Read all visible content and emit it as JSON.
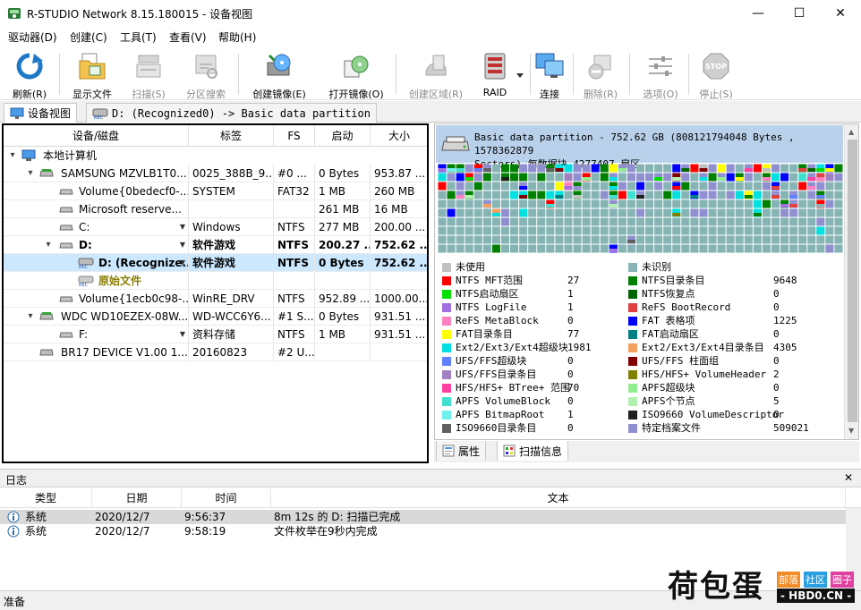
{
  "window": {
    "title": "R-STUDIO Network 8.15.180015 - 设备视图",
    "minimize": "—",
    "maximize": "☐",
    "close": "✕"
  },
  "menu": [
    "驱动器(D)",
    "创建(C)",
    "工具(T)",
    "查看(V)",
    "帮助(H)"
  ],
  "toolbar": {
    "refresh": "刷新(R)",
    "show_files": "显示文件",
    "scan": "扫描(S)",
    "partition_search": "分区搜索",
    "create_image": "创建镜像(E)",
    "open_image": "打开镜像(O)",
    "create_region": "创建区域(R)",
    "raid": "RAID",
    "connect": "连接",
    "delete": "删除(R)",
    "options": "选项(O)",
    "stop": "停止(S)",
    "stop_icon_text": "STOP"
  },
  "tabs": {
    "device_view": "设备视图",
    "partition_tab": "D: (Recognized0) -> Basic data partition"
  },
  "devices": {
    "columns": [
      "设备/磁盘",
      "标签",
      "FS",
      "启动",
      "大小"
    ],
    "rows": [
      {
        "name": "本地计算机",
        "label": "",
        "fs": "",
        "start": "",
        "size": ""
      },
      {
        "name": "SAMSUNG MZVLB1T0...",
        "label": "0025_388B_9...",
        "fs": "#0 ...",
        "start": "0 Bytes",
        "size": "953.87 ..."
      },
      {
        "name": "Volume{0bedecf0-...",
        "label": "SYSTEM",
        "fs": "FAT32",
        "start": "1 MB",
        "size": "260 MB"
      },
      {
        "name": "Microsoft reserve...",
        "label": "",
        "fs": "",
        "start": "261 MB",
        "size": "16 MB"
      },
      {
        "name": "C:",
        "label": "Windows",
        "fs": "NTFS",
        "start": "277 MB",
        "size": "200.00 ..."
      },
      {
        "name": "D:",
        "label": "软件游戏",
        "fs": "NTFS",
        "start": "200.27 ...",
        "size": "752.62 ..."
      },
      {
        "name": "D: (Recognize...",
        "label": "软件游戏",
        "fs": "NTFS",
        "start": "0 Bytes",
        "size": "752.62 ..."
      },
      {
        "name": "原始文件",
        "label": "",
        "fs": "",
        "start": "",
        "size": ""
      },
      {
        "name": "Volume{1ecb0c98-...",
        "label": "WinRE_DRV",
        "fs": "NTFS",
        "start": "952.89 ...",
        "size": "1000.00..."
      },
      {
        "name": "WDC WD10EZEX-08W...",
        "label": "WD-WCC6Y6...",
        "fs": "#1 S...",
        "start": "0 Bytes",
        "size": "931.51 ..."
      },
      {
        "name": "F:",
        "label": "资料存储",
        "fs": "NTFS",
        "start": "1 MB",
        "size": "931.51 ..."
      },
      {
        "name": "BR17 DEVICE V1.00 1...",
        "label": "20160823",
        "fs": "#2 U...",
        "start": "",
        "size": ""
      }
    ]
  },
  "map": {
    "header_line1": "Basic data partition - 752.62 GB (808121794048 Bytes , 1578362879",
    "header_line2": "Sectors) 每数据块 4277407 扇区",
    "legend": [
      {
        "name": "未使用",
        "value": "",
        "color": "#c0c0c0"
      },
      {
        "name": "未识别",
        "value": "",
        "color": "#86b4b4"
      },
      {
        "name": "NTFS MFT范围",
        "value": "27",
        "color": "#ff0000"
      },
      {
        "name": "NTFS目录条目",
        "value": "9648",
        "color": "#008000"
      },
      {
        "name": "NTFS启动扇区",
        "value": "1",
        "color": "#00e000"
      },
      {
        "name": "NTFS恢复点",
        "value": "0",
        "color": "#006400"
      },
      {
        "name": "NTFS LogFile",
        "value": "1",
        "color": "#a070e0"
      },
      {
        "name": "ReFS BootRecord",
        "value": "0",
        "color": "#e04040"
      },
      {
        "name": "ReFS MetaBlock",
        "value": "0",
        "color": "#ff80c0"
      },
      {
        "name": "FAT 表格项",
        "value": "1225",
        "color": "#0000ff"
      },
      {
        "name": "FAT目录条目",
        "value": "77",
        "color": "#ffff00"
      },
      {
        "name": "FAT启动扇区",
        "value": "0",
        "color": "#008080"
      },
      {
        "name": "Ext2/Ext3/Ext4超级块",
        "value": "1981",
        "color": "#00e0e0"
      },
      {
        "name": "Ext2/Ext3/Ext4目录条目",
        "value": "4305",
        "color": "#f4a060"
      },
      {
        "name": "UFS/FFS超级块",
        "value": "0",
        "color": "#6080ff"
      },
      {
        "name": "UFS/FFS 柱面组",
        "value": "0",
        "color": "#800000"
      },
      {
        "name": "UFS/FFS目录条目",
        "value": "0",
        "color": "#a080c0"
      },
      {
        "name": "HFS/HFS+ VolumeHeader",
        "value": "2",
        "color": "#808000"
      },
      {
        "name": "HFS/HFS+ BTree+ 范围",
        "value": "70",
        "color": "#ff40a0"
      },
      {
        "name": "APFS超级块",
        "value": "0",
        "color": "#90ee90"
      },
      {
        "name": "APFS VolumeBlock",
        "value": "0",
        "color": "#40e0d0"
      },
      {
        "name": "APFS个节点",
        "value": "5",
        "color": "#b0f0b0"
      },
      {
        "name": "APFS BitmapRoot",
        "value": "1",
        "color": "#70f0f0"
      },
      {
        "name": "ISO9660 VolumeDescriptor",
        "value": "0",
        "color": "#202020"
      },
      {
        "name": "ISO9660目录条目",
        "value": "0",
        "color": "#606060"
      },
      {
        "name": "特定档案文件",
        "value": "509021",
        "color": "#9090d0"
      }
    ]
  },
  "right_tabs": {
    "properties": "属性",
    "scan_info": "扫描信息"
  },
  "log": {
    "title": "日志",
    "close": "✕",
    "columns": [
      "类型",
      "日期",
      "时间",
      "文本"
    ],
    "rows": [
      {
        "type": "系统",
        "date": "2020/12/7",
        "time": "9:56:37",
        "text": "8m 12s 的 D: 扫描已完成"
      },
      {
        "type": "系统",
        "date": "2020/12/7",
        "time": "9:58:19",
        "text": "文件枚举在9秒内完成"
      }
    ]
  },
  "status": {
    "text": "准备"
  },
  "watermark": {
    "main": "荷包蛋",
    "tags": [
      "部落",
      "社区",
      "圈子"
    ],
    "site": "- HBD0.CN -"
  }
}
